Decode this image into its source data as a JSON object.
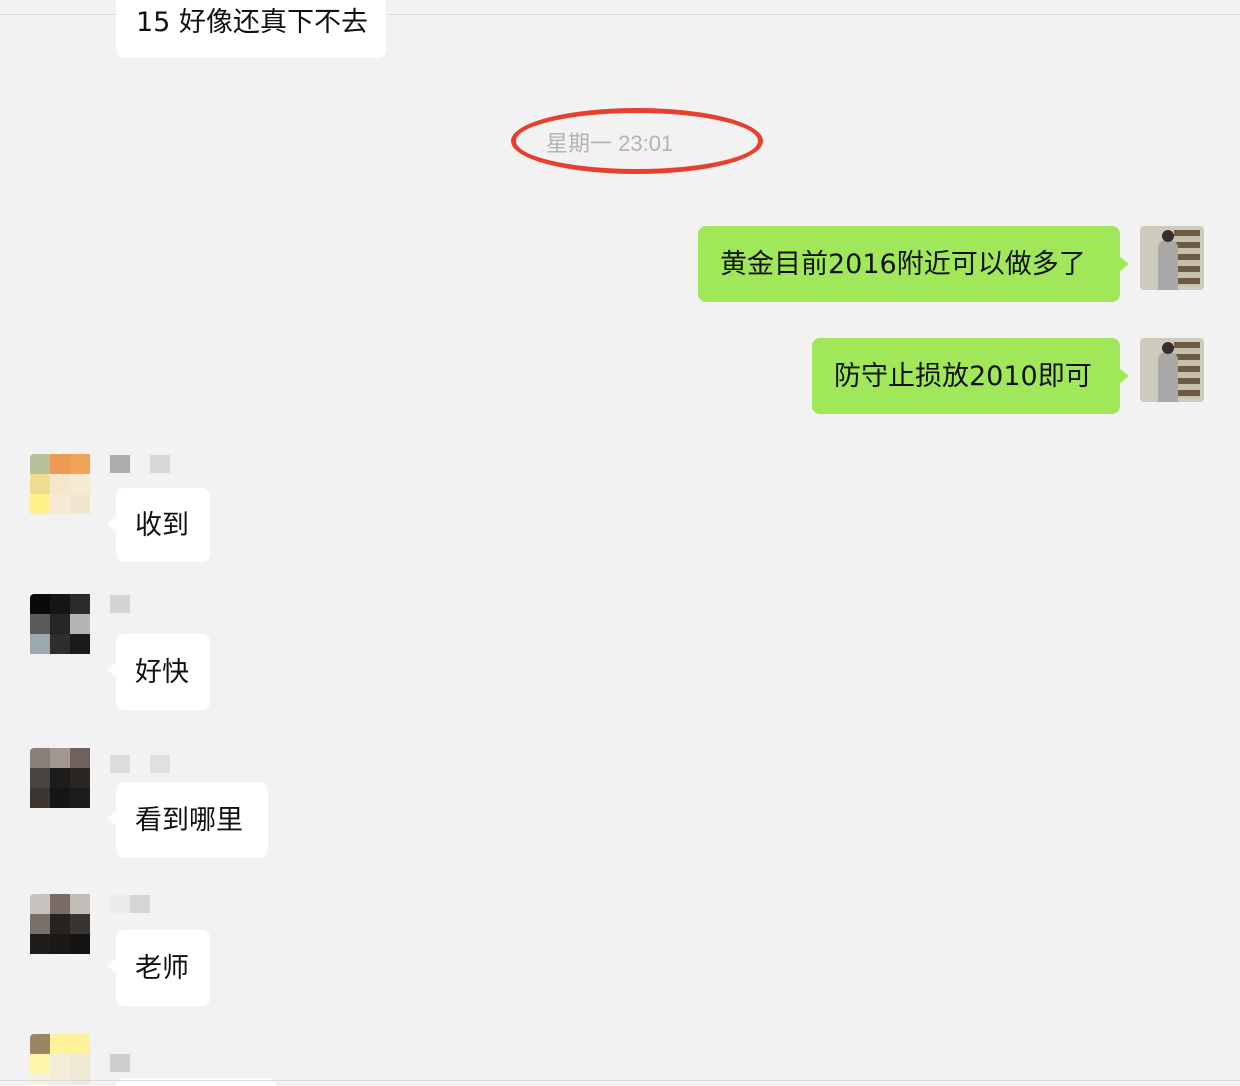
{
  "chat": {
    "partial_top_message": "15 好像还真下不去",
    "timestamp": "星期一 23:01",
    "messages": [
      {
        "id": "m1",
        "side": "right",
        "text": "黄金目前2016附近可以做多了"
      },
      {
        "id": "m2",
        "side": "right",
        "text": "防守止损放2010即可"
      },
      {
        "id": "m3",
        "side": "left",
        "text": "收到"
      },
      {
        "id": "m4",
        "side": "left",
        "text": "好快"
      },
      {
        "id": "m5",
        "side": "left",
        "text": "看到哪里"
      },
      {
        "id": "m6",
        "side": "left",
        "text": "老师"
      }
    ]
  },
  "colors": {
    "background": "#f2f2f2",
    "outgoing_bubble": "#a0e75a",
    "incoming_bubble": "#ffffff",
    "annotation_circle": "#e8402f",
    "timestamp_text": "#b3b3b3"
  }
}
